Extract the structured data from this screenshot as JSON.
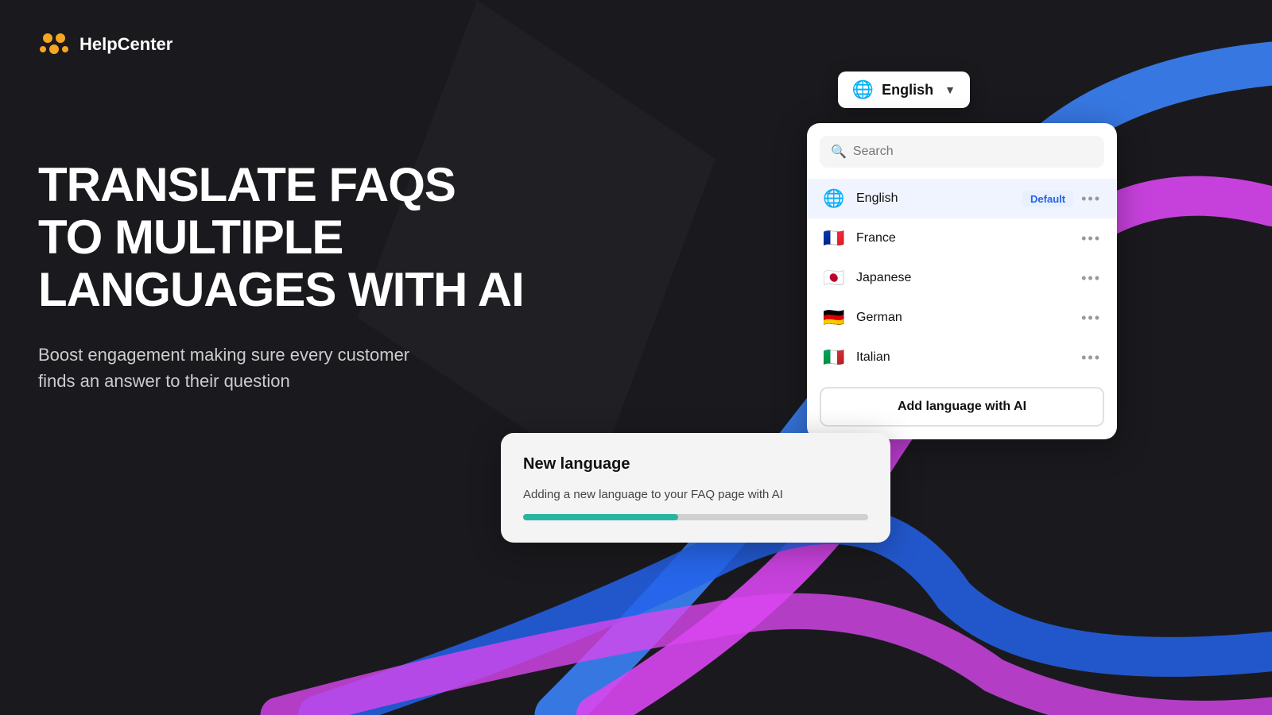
{
  "logo": {
    "name": "HelpCenter",
    "icon_color": "#f5a623"
  },
  "hero": {
    "heading": "Translate FAQs to multiple languages with AI",
    "subtext": "Boost engagement making sure every customer finds an answer to their question"
  },
  "lang_selector": {
    "selected": "English",
    "globe": "🌐"
  },
  "search": {
    "placeholder": "Search"
  },
  "languages": [
    {
      "name": "English",
      "flag": "🌐",
      "is_default": true,
      "badge": "Default"
    },
    {
      "name": "France",
      "flag": "🇫🇷",
      "is_default": false
    },
    {
      "name": "Japanese",
      "flag": "🇯🇵",
      "is_default": false
    },
    {
      "name": "German",
      "flag": "🇩🇪",
      "is_default": false
    },
    {
      "name": "Italian",
      "flag": "🇮🇹",
      "is_default": false
    }
  ],
  "add_button": {
    "label": "Add language with AI"
  },
  "progress_card": {
    "title": "New language",
    "description": "Adding a new language to your FAQ page with AI",
    "progress": 45
  },
  "colors": {
    "accent_blue": "#4f46e5",
    "accent_magenta": "#d946ef",
    "accent_teal": "#2ab5a0",
    "bg": "#1a1a1e"
  }
}
